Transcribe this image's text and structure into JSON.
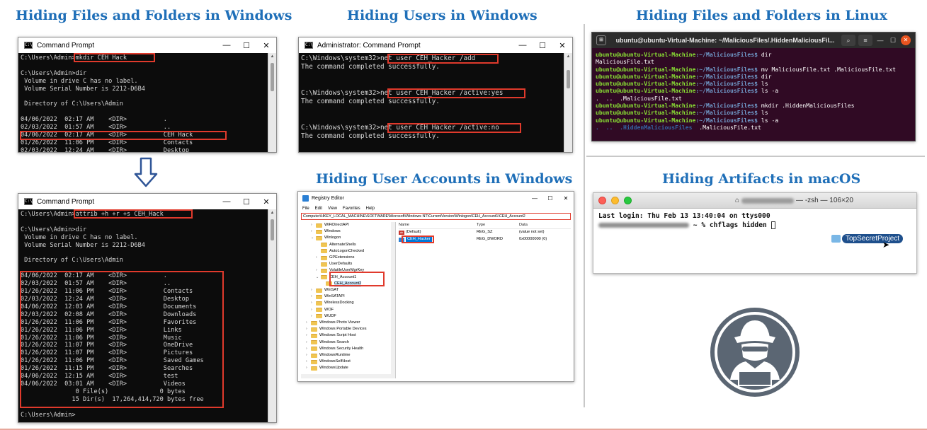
{
  "titles": {
    "win_files": "Hiding Files and Folders in Windows",
    "win_users": "Hiding Users in Windows",
    "linux_files": "Hiding Files and Folders in Linux",
    "win_accounts": "Hiding User Accounts in Windows",
    "macos": "Hiding Artifacts in macOS"
  },
  "cmd1": {
    "title": "Command Prompt",
    "lines": [
      "C:\\Users\\Admin>mkdir CEH Hack",
      "",
      "C:\\Users\\Admin>dir",
      " Volume in drive C has no label.",
      " Volume Serial Number is 2212-D6B4",
      "",
      " Directory of C:\\Users\\Admin",
      "",
      "04/06/2022  02:17 AM    <DIR>          .",
      "02/03/2022  01:57 AM    <DIR>          ..",
      "04/06/2022  02:17 AM    <DIR>          CEH Hack",
      "01/26/2022  11:06 PM    <DIR>          Contacts",
      "02/03/2022  12:24 AM    <DIR>          Desktop"
    ]
  },
  "cmd2": {
    "title": "Administrator: Command Prompt",
    "lines": [
      "C:\\Windows\\system32>net user CEH_Hacker /add",
      "The command completed successfully.",
      "",
      "",
      "C:\\Windows\\system32>net user CEH_Hacker /active:yes",
      "The command completed successfully.",
      "",
      "",
      "C:\\Windows\\system32>net user CEH_Hacker /active:no",
      "The command completed successfully."
    ]
  },
  "cmd3": {
    "title": "Command Prompt",
    "lines": [
      "C:\\Users\\Admin>attrib +h +r +s CEH_Hack",
      "",
      "C:\\Users\\Admin>dir",
      " Volume in drive C has no label.",
      " Volume Serial Number is 2212-D6B4",
      "",
      " Directory of C:\\Users\\Admin",
      "",
      "04/06/2022  02:17 AM    <DIR>          .",
      "02/03/2022  01:57 AM    <DIR>          ..",
      "01/26/2022  11:06 PM    <DIR>          Contacts",
      "02/03/2022  12:24 AM    <DIR>          Desktop",
      "04/06/2022  12:03 AM    <DIR>          Documents",
      "02/03/2022  02:08 AM    <DIR>          Downloads",
      "01/26/2022  11:06 PM    <DIR>          Favorites",
      "01/26/2022  11:06 PM    <DIR>          Links",
      "01/26/2022  11:06 PM    <DIR>          Music",
      "01/26/2022  11:07 PM    <DIR>          OneDrive",
      "01/26/2022  11:07 PM    <DIR>          Pictures",
      "01/26/2022  11:06 PM    <DIR>          Saved Games",
      "01/26/2022  11:15 PM    <DIR>          Searches",
      "04/06/2022  12:15 AM    <DIR>          test",
      "04/06/2022  03:01 AM    <DIR>          Videos",
      "               0 File(s)              0 bytes",
      "              15 Dir(s)  17,264,414,720 bytes free",
      "",
      "C:\\Users\\Admin>"
    ]
  },
  "ubuntu": {
    "title": "ubuntu@ubuntu-Virtual-Machine: ~/MaliciousFiles/.HiddenMaliciousFil...",
    "prompt_user": "ubuntu@ubuntu-Virtual-Machine",
    "prompt_path": ":~/MaliciousFiles$",
    "lines": [
      {
        "type": "cmd",
        "text": " dir"
      },
      {
        "type": "out",
        "text": "MaliciousFile.txt"
      },
      {
        "type": "cmd",
        "text": " mv MaliciousFile.txt .MaliciousFile.txt"
      },
      {
        "type": "cmd",
        "text": " dir"
      },
      {
        "type": "cmd",
        "text": " ls"
      },
      {
        "type": "cmd",
        "text": " ls -a"
      },
      {
        "type": "out",
        "text": ".  ..  .MaliciousFile.txt"
      },
      {
        "type": "cmd",
        "text": " mkdir .HiddenMaliciousFiles"
      },
      {
        "type": "cmd",
        "text": " ls"
      },
      {
        "type": "cmd",
        "text": " ls -a"
      },
      {
        "type": "dirs",
        "text": ".  ..  .HiddenMaliciousFiles",
        "tail": "  .MaliciousFile.txt"
      }
    ]
  },
  "regedit": {
    "title": "Registry Editor",
    "menu": [
      "File",
      "Edit",
      "View",
      "Favorites",
      "Help"
    ],
    "address": "Computer\\HKEY_LOCAL_MACHINE\\SOFTWARE\\Microsoft\\Windows NT\\CurrentVersion\\Winlogon\\CEH_Account1\\CEH_Account2",
    "tree": [
      {
        "label": "WiFiDirectAPI",
        "indent": 2,
        "exp": ">"
      },
      {
        "label": "Windows",
        "indent": 2,
        "exp": ">"
      },
      {
        "label": "Winlogon",
        "indent": 2,
        "exp": "v"
      },
      {
        "label": "AlternateShells",
        "indent": 3,
        "exp": ""
      },
      {
        "label": "AutoLogonChecked",
        "indent": 3,
        "exp": ""
      },
      {
        "label": "GPExtensions",
        "indent": 3,
        "exp": ">"
      },
      {
        "label": "UserDefaults",
        "indent": 3,
        "exp": ""
      },
      {
        "label": "VolatileUserMgrKey",
        "indent": 3,
        "exp": ">"
      },
      {
        "label": "CEH_Account1",
        "indent": 3,
        "exp": "v"
      },
      {
        "label": "CEH_Account2",
        "indent": 4,
        "exp": "",
        "selected": true
      },
      {
        "label": "WinSAT",
        "indent": 2,
        "exp": ">"
      },
      {
        "label": "WinSATAPI",
        "indent": 2,
        "exp": ">"
      },
      {
        "label": "WirelessDocking",
        "indent": 2,
        "exp": ">"
      },
      {
        "label": "WOF",
        "indent": 2,
        "exp": ">"
      },
      {
        "label": "WUDF",
        "indent": 2,
        "exp": ">"
      },
      {
        "label": "Windows Photo Viewer",
        "indent": 1,
        "exp": ">"
      },
      {
        "label": "Windows Portable Devices",
        "indent": 1,
        "exp": ">"
      },
      {
        "label": "Windows Script Host",
        "indent": 1,
        "exp": ">"
      },
      {
        "label": "Windows Search",
        "indent": 1,
        "exp": ">"
      },
      {
        "label": "Windows Security Health",
        "indent": 1,
        "exp": ">"
      },
      {
        "label": "WindowsRuntime",
        "indent": 1,
        "exp": ">"
      },
      {
        "label": "WindowsSelfHost",
        "indent": 1,
        "exp": ">"
      },
      {
        "label": "WindowsUpdate",
        "indent": 1,
        "exp": ">"
      }
    ],
    "columns": [
      "Name",
      "Type",
      "Data"
    ],
    "values": [
      {
        "name": "(Default)",
        "type": "REG_SZ",
        "data": "(value not set)",
        "icon": "ab"
      },
      {
        "name": "CEH_Hacker",
        "type": "REG_DWORD",
        "data": "0x00000000 (0)",
        "icon": "bin",
        "selected": true
      }
    ]
  },
  "mac": {
    "title_suffix": "— -zsh — 106×20",
    "line1": "Last login: Thu Feb 13 13:40:04 on ttys000",
    "line2_tail": " ~ % chflags hidden ",
    "file_label": "TopSecretProject"
  },
  "colors": {
    "title_blue": "#1f6fb8",
    "highlight_red": "#e03a2c",
    "ubuntu_bg": "#300a24",
    "hacker_circle": "#5b6673"
  }
}
